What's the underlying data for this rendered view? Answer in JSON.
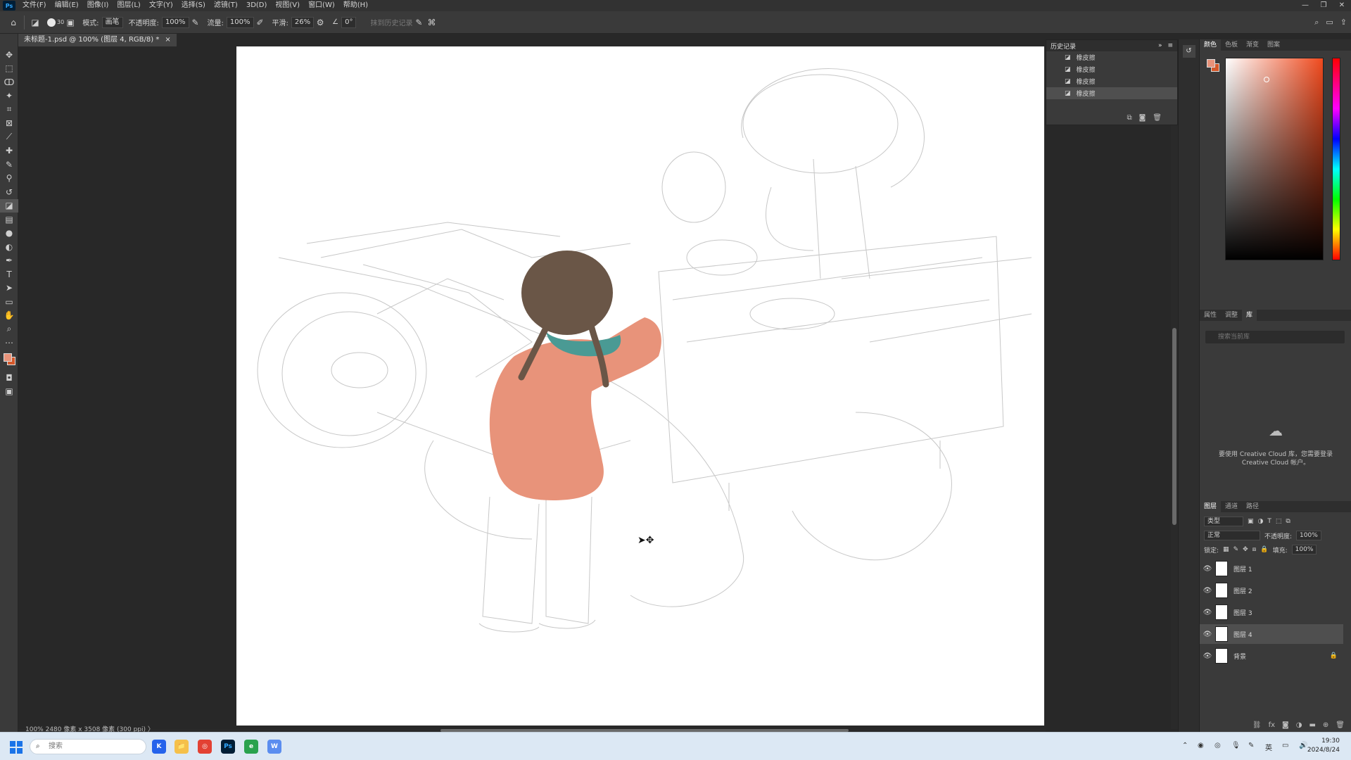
{
  "app": {
    "name": "Ps"
  },
  "menu": [
    "文件(F)",
    "编辑(E)",
    "图像(I)",
    "图层(L)",
    "文字(Y)",
    "选择(S)",
    "滤镜(T)",
    "3D(D)",
    "视图(V)",
    "窗口(W)",
    "帮助(H)"
  ],
  "window_controls": [
    "—",
    "❐",
    "✕"
  ],
  "options": {
    "brush_size": "30",
    "mode_label": "模式:",
    "mode_value": "画笔",
    "opacity_label": "不透明度:",
    "opacity_value": "100%",
    "flow_label": "流量:",
    "flow_value": "100%",
    "smooth_label": "平滑:",
    "smooth_value": "26%",
    "angle_value": "0°",
    "erase_history": "抹到历史记录"
  },
  "document": {
    "tab_title": "未标题-1.psd @ 100% (图层 4, RGB/8) *",
    "close": "×"
  },
  "status": "100%    2480 像素 x 3508 像素 (300 ppi)   〉",
  "history": {
    "title": "历史记录",
    "items": [
      "橡皮擦",
      "橡皮擦",
      "橡皮擦",
      "橡皮擦"
    ],
    "selected_index": 3
  },
  "color_panel": {
    "tabs": [
      "颜色",
      "色板",
      "渐变",
      "图案"
    ],
    "fg": "#e8937a",
    "bg": "#d4582a"
  },
  "library_panel": {
    "tabs": [
      "属性",
      "调整",
      "库"
    ],
    "search_placeholder": "搜索当前库",
    "message_line1": "要使用 Creative Cloud 库，您需要登录",
    "message_line2": "Creative Cloud 帐户。"
  },
  "layers_panel": {
    "tabs": [
      "图层",
      "通道",
      "路径"
    ],
    "kind_filter": "类型",
    "blend_mode": "正常",
    "opacity_label": "不透明度:",
    "opacity_value": "100%",
    "lock_label": "锁定:",
    "fill_label": "填充:",
    "fill_value": "100%",
    "layers": [
      {
        "name": "图层 1",
        "selected": false,
        "locked": false
      },
      {
        "name": "图层 2",
        "selected": false,
        "locked": false
      },
      {
        "name": "图层 3",
        "selected": false,
        "locked": false
      },
      {
        "name": "图层 4",
        "selected": true,
        "locked": false
      },
      {
        "name": "背景",
        "selected": false,
        "locked": true
      }
    ]
  },
  "taskbar": {
    "search_placeholder": "搜索",
    "apps": [
      "K",
      "📁",
      "◎",
      "Ps",
      "e",
      "W"
    ],
    "ime": "英",
    "time": "19:30",
    "date": "2024/8/24"
  },
  "illustration": {
    "hair_color": "#6a5647",
    "coat_color": "#e8937a",
    "scarf_color": "#4a9a94"
  }
}
